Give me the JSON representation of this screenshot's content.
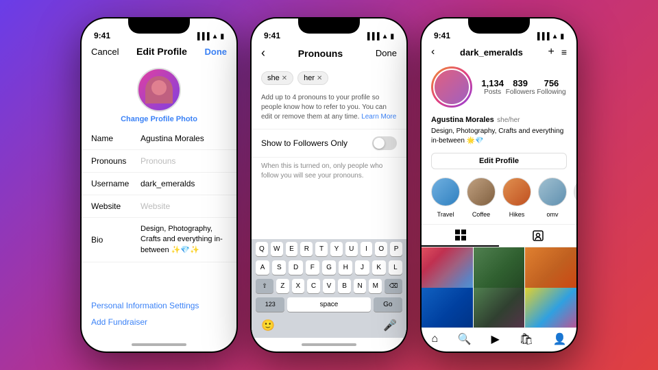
{
  "background": "linear-gradient(135deg, #6a3de8 0%, #c03080 50%, #e04040 100%)",
  "phone1": {
    "status_time": "9:41",
    "nav": {
      "cancel": "Cancel",
      "title": "Edit Profile",
      "done": "Done"
    },
    "avatar": {
      "change_photo": "Change Profile Photo"
    },
    "form": {
      "name_label": "Name",
      "name_value": "Agustina Morales",
      "pronouns_label": "Pronouns",
      "pronouns_placeholder": "Pronouns",
      "username_label": "Username",
      "username_value": "dark_emeralds",
      "website_label": "Website",
      "website_placeholder": "Website",
      "bio_label": "Bio",
      "bio_value": "Design, Photography, Crafts and everything in-between ✨💎✨"
    },
    "links": {
      "personal_info": "Personal Information Settings",
      "fundraiser": "Add Fundraiser"
    }
  },
  "phone2": {
    "status_time": "9:41",
    "nav": {
      "title": "Pronouns",
      "done": "Done"
    },
    "tags": [
      "she",
      "her"
    ],
    "description": "Add up to 4 pronouns to your profile so people know how to refer to you. You can edit or remove them at any time.",
    "learn_more": "Learn More",
    "toggle": {
      "label": "Show to Followers Only",
      "state": "off"
    },
    "toggle_note": "When this is turned on, only people who follow you will see your pronouns.",
    "keyboard": {
      "rows": [
        [
          "Q",
          "W",
          "E",
          "R",
          "T",
          "Y",
          "U",
          "I",
          "O",
          "P"
        ],
        [
          "A",
          "S",
          "D",
          "F",
          "G",
          "H",
          "J",
          "K",
          "L"
        ],
        [
          "Z",
          "X",
          "C",
          "V",
          "B",
          "N",
          "M"
        ]
      ],
      "special_left": "⇧",
      "special_right": "⌫",
      "nums": "123",
      "space": "space",
      "go": "Go",
      "emoji": "😊",
      "mic": "🎤"
    }
  },
  "phone3": {
    "status_time": "9:41",
    "nav": {
      "username": "dark_emeralds"
    },
    "stats": {
      "posts_count": "1,134",
      "posts_label": "Posts",
      "followers_count": "839",
      "followers_label": "Followers",
      "following_count": "756",
      "following_label": "Following"
    },
    "user": {
      "name": "Agustina Morales",
      "pronouns": "she/her",
      "bio": "Design, Photography, Crafts and everything\nin-between 🌟💎"
    },
    "edit_profile_btn": "Edit Profile",
    "highlights": [
      {
        "label": "Travel",
        "class": "travel"
      },
      {
        "label": "Coffee",
        "class": "coffee"
      },
      {
        "label": "Hikes",
        "class": "hikes"
      },
      {
        "label": "omv",
        "class": "omv"
      }
    ]
  }
}
